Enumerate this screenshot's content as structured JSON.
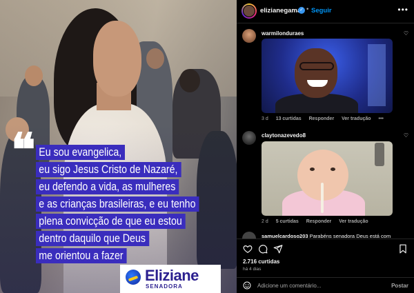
{
  "post_image": {
    "quote_lines": [
      "Eu sou evangelica,",
      "eu sigo Jesus Cristo de Nazaré,",
      "eu defendo a vida, as mulheres",
      "e as crianças brasileiras, e eu tenho",
      "plena convicção de que eu estou",
      "dentro daquilo que Deus",
      "me orientou a fazer"
    ],
    "brand_name": "Eliziane",
    "brand_sub": "SENADORA",
    "brand_color": "#2b1f8f",
    "quote_bg_color": "#3a2dbd"
  },
  "header": {
    "username": "elizianegama",
    "dot": "•",
    "follow_label": "Seguir",
    "more_label": "•••"
  },
  "comments": [
    {
      "username": "warmilonduraes",
      "time": "3 d",
      "likes": "13 curtidas",
      "reply_label": "Responder",
      "translate_label": "Ver tradução",
      "more_label": "•••"
    },
    {
      "username": "claytonazevedo8",
      "time": "2 d",
      "likes": "5 curtidas",
      "reply_label": "Responder",
      "translate_label": "Ver tradução"
    }
  ],
  "truncated_comment": {
    "username": "samuelcardoso203",
    "text": "Parabéns senadora Deus está com"
  },
  "footer": {
    "likes": "2.716 curtidas",
    "ago": "há 4 dias",
    "comment_placeholder": "Adicione um comentário...",
    "post_label": "Postar"
  },
  "colors": {
    "accent": "#0095f6",
    "verified": "#3897f0",
    "muted": "#a8a8a8"
  }
}
